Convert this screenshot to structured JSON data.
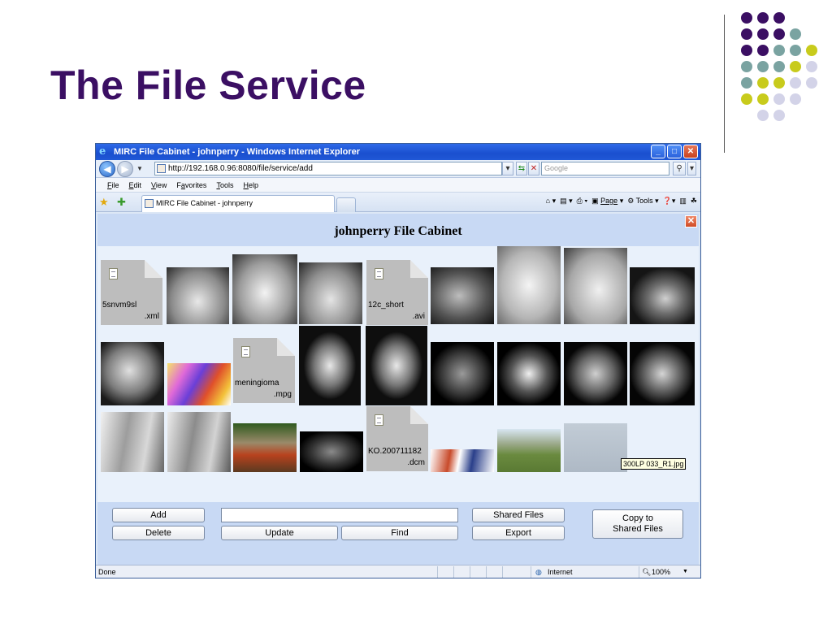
{
  "slide": {
    "title": "The File Service",
    "dot_colors": [
      "#3b0f63",
      "#7aa3a1",
      "#c8cb1c",
      "#d3d3e8"
    ]
  },
  "browser": {
    "window_title": "MIRC File Cabinet - johnperry - Windows Internet Explorer",
    "address": "http://192.168.0.96:8080/file/service/add",
    "search_placeholder": "Google",
    "menu": [
      {
        "key": "F",
        "rest": "ile"
      },
      {
        "key": "E",
        "rest": "dit"
      },
      {
        "key": "V",
        "rest": "iew"
      },
      {
        "key": "a",
        "pre": "F",
        "rest": "vorites"
      },
      {
        "key": "T",
        "rest": "ools"
      },
      {
        "key": "H",
        "rest": "elp"
      }
    ],
    "tab_label": "MIRC File Cabinet - johnperry",
    "commands": {
      "page": "Page",
      "tools": "Tools"
    },
    "status": {
      "text": "Done",
      "zone": "Internet",
      "zoom": "100%"
    }
  },
  "cabinet": {
    "title": "johnperry File Cabinet",
    "files": [
      {
        "name": "5snvm9sl",
        "ext": ".xml"
      },
      {
        "name": "12c_short",
        "ext": ".avi"
      },
      {
        "name": "meningioma",
        "ext": ".mpg"
      },
      {
        "name": "KO.200711182",
        "ext": ".dcm"
      }
    ],
    "tooltip": "300LP 033_R1.jpg"
  },
  "footer": {
    "add": "Add",
    "delete": "Delete",
    "update": "Update",
    "find": "Find",
    "shared_files": "Shared Files",
    "export": "Export",
    "copy_to_shared": "Copy to\nShared Files",
    "text_value": ""
  }
}
